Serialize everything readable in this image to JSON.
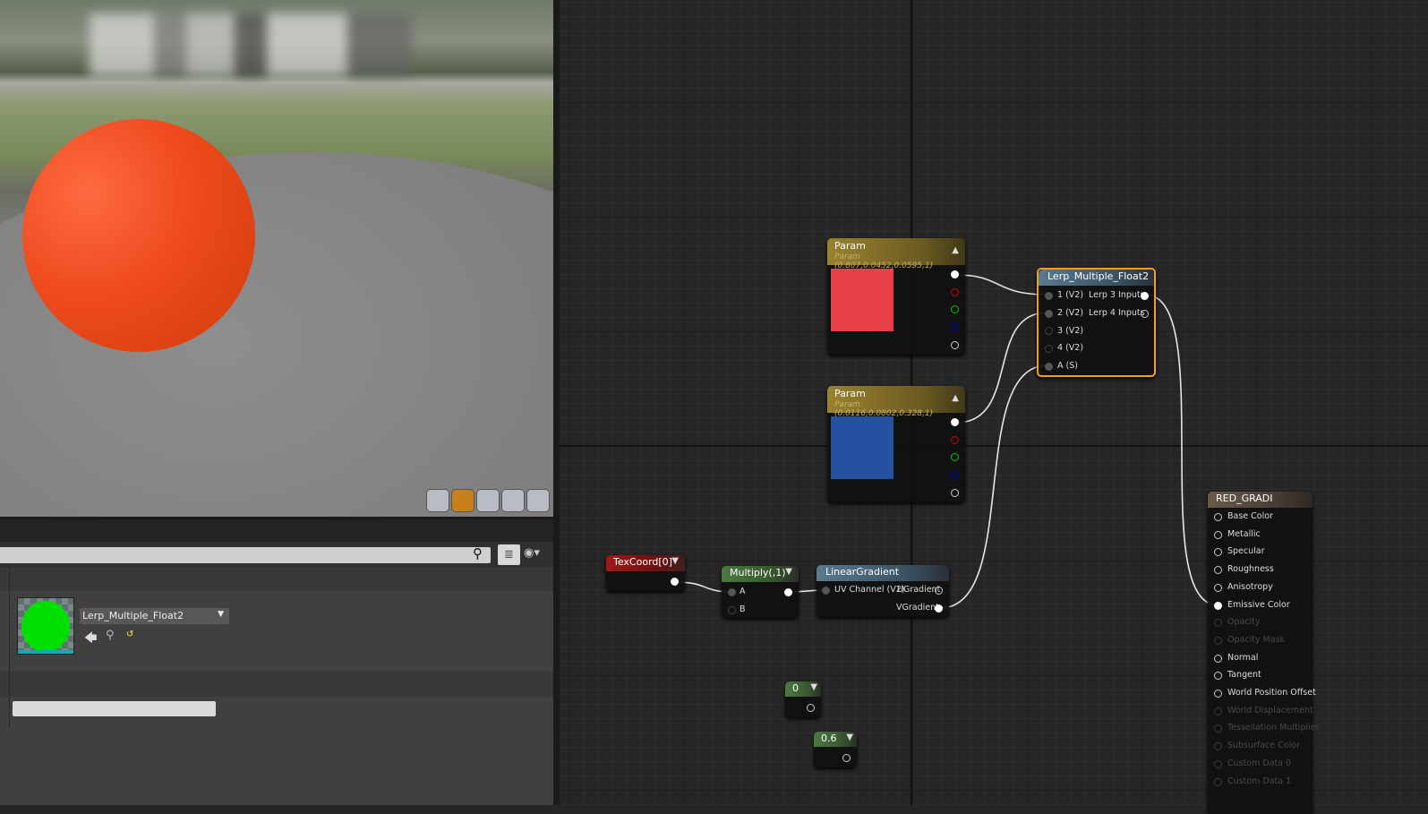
{
  "viewport": {
    "tools": [
      "cylinder",
      "sphere",
      "plane",
      "cube",
      "teapot"
    ],
    "active": "sphere"
  },
  "details": {
    "asset_name": "Lerp_Multiple_Float2",
    "thumbnail_color": "#00e000"
  },
  "nodes": {
    "param1": {
      "title": "Param",
      "subtitle": "Param (0.807,0.0452,0.0595,1)",
      "color": "#e8404a"
    },
    "param2": {
      "title": "Param",
      "subtitle": "Param (0.0116,0.0802,0.328,1)",
      "color": "#2451a0"
    },
    "lerp": {
      "title": "Lerp_Multiple_Float2",
      "inputs": [
        "1 (V2)",
        "2 (V2)",
        "3 (V2)",
        "4 (V2)",
        "A (S)"
      ],
      "outputs": [
        "Lerp 3 Inputs",
        "Lerp 4 Inputs"
      ]
    },
    "texcoord": {
      "title": "TexCoord[0]"
    },
    "multiply": {
      "title": "Multiply(,1)",
      "inputs": [
        "A",
        "B"
      ]
    },
    "lineargradient": {
      "title": "LinearGradient",
      "input": "UV Channel (V2)",
      "outputs": [
        "UGradient",
        "VGradient"
      ]
    },
    "const0": {
      "title": "0"
    },
    "const06": {
      "title": "0.6"
    },
    "material": {
      "title": "RED_GRADI",
      "inputs": [
        {
          "label": "Base Color",
          "enabled": true
        },
        {
          "label": "Metallic",
          "enabled": true
        },
        {
          "label": "Specular",
          "enabled": true
        },
        {
          "label": "Roughness",
          "enabled": true
        },
        {
          "label": "Anisotropy",
          "enabled": true
        },
        {
          "label": "Emissive Color",
          "enabled": true
        },
        {
          "label": "Opacity",
          "enabled": false
        },
        {
          "label": "Opacity Mask",
          "enabled": false
        },
        {
          "label": "Normal",
          "enabled": true
        },
        {
          "label": "Tangent",
          "enabled": true
        },
        {
          "label": "World Position Offset",
          "enabled": true
        },
        {
          "label": "World Displacement",
          "enabled": false
        },
        {
          "label": "Tessellation Multiplier",
          "enabled": false
        },
        {
          "label": "Subsurface Color",
          "enabled": false
        },
        {
          "label": "Custom Data 0",
          "enabled": false
        },
        {
          "label": "Custom Data 1",
          "enabled": false
        }
      ]
    }
  }
}
